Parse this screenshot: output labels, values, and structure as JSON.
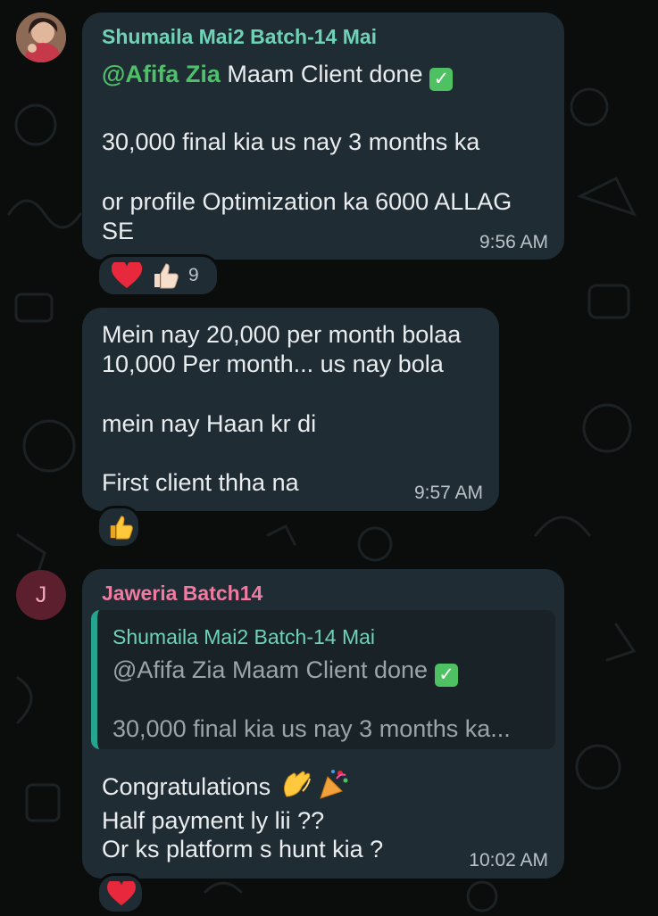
{
  "messages": [
    {
      "sender": "Shumaila Mai2 Batch-14 Mai",
      "mention": "@Afifa Zia",
      "line1_rest": " Maam Client done",
      "line2": "30,000 final kia us nay 3 months ka",
      "line3": "or profile Optimization ka 6000 ALLAG",
      "line4": "SE",
      "time": "9:56 AM",
      "reaction_count": "9"
    },
    {
      "line1": "Mein nay 20,000 per month bolaa",
      "line2": "10,000 Per month... us nay bola",
      "line3": "mein nay Haan kr di",
      "line4": "First client thha na",
      "time": "9:57 AM"
    },
    {
      "sender": "Jaweria Batch14",
      "avatar_letter": "J",
      "quote": {
        "sender": "Shumaila Mai2 Batch-14 Mai",
        "line1": "@Afifa Zia Maam Client done",
        "line2": "30,000 final kia us nay 3 months ka..."
      },
      "line1": "Congratulations",
      "line2": "Half payment ly lii ??",
      "line3": "Or ks platform s hunt kia ?",
      "time": "10:02 AM"
    }
  ],
  "colors": {
    "background": "#0b0d0d",
    "bubble": "#202c33",
    "sender_green": "#6ed3b6",
    "sender_pink": "#f07aa0",
    "mention": "#4fc06a",
    "quote_bar": "#25a58f",
    "avatar_j": "#5c1f2e"
  },
  "icons": [
    "check-mark-emoji",
    "heart-emoji",
    "thumbs-up-light-emoji",
    "thumbs-up-emoji",
    "clapping-hands-emoji",
    "party-popper-emoji"
  ]
}
